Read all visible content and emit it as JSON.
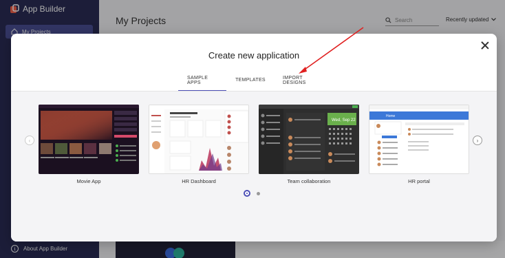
{
  "app": {
    "brand": "App Builder",
    "nav_active": "My Projects",
    "about": "About App Builder"
  },
  "main": {
    "title": "My Projects",
    "search_placeholder": "Search",
    "sort_label": "Recently updated"
  },
  "dialog": {
    "title": "Create new application",
    "tabs": [
      "SAMPLE APPS",
      "TEMPLATES",
      "IMPORT DESIGNS"
    ],
    "active_tab": 0,
    "cards": [
      {
        "label": "Movie App"
      },
      {
        "label": "HR Dashboard"
      },
      {
        "label": "Team collaboration"
      },
      {
        "label": "HR portal"
      }
    ],
    "pager": {
      "pages": 2,
      "current": 1
    }
  },
  "colors": {
    "sidebar": "#2a2c54",
    "accent": "#4c4fb6",
    "arrow": "#e02020"
  }
}
